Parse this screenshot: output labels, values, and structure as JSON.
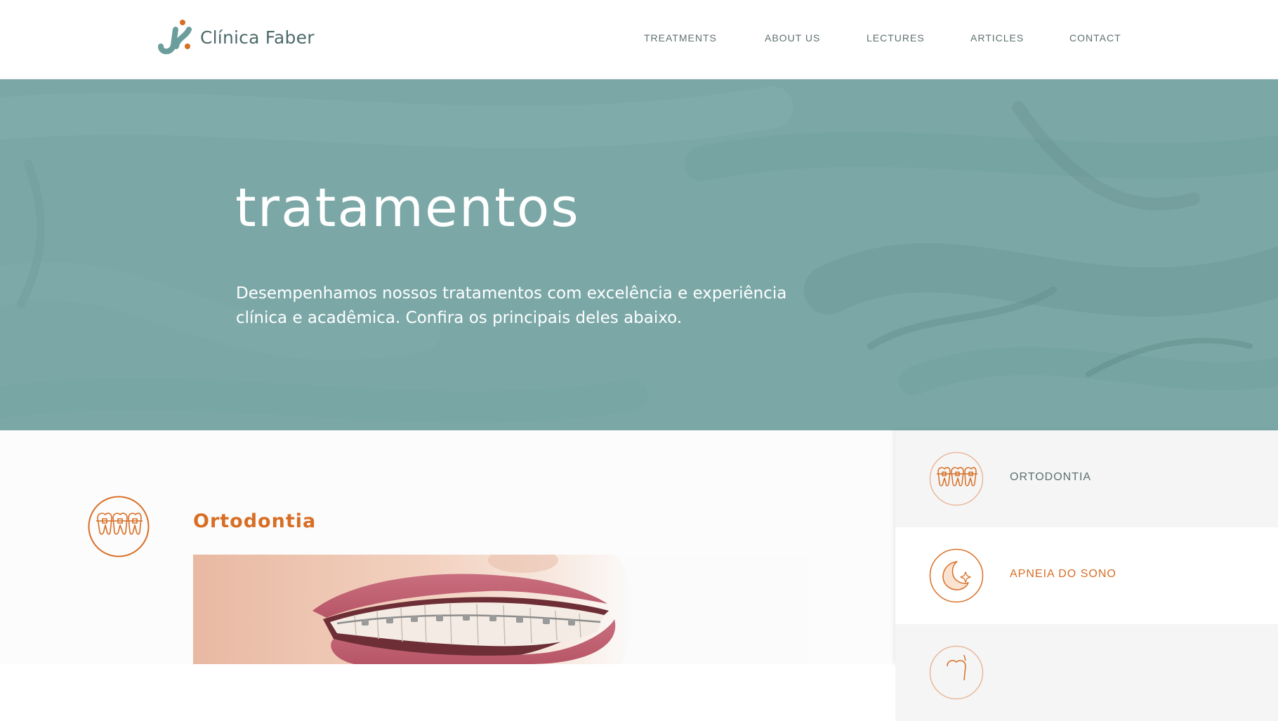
{
  "brand": {
    "name": "Clínica Faber",
    "accent_teal": "#6b9d9c",
    "accent_orange": "#d86e25"
  },
  "nav": {
    "items": [
      {
        "label": "TREATMENTS"
      },
      {
        "label": "ABOUT US"
      },
      {
        "label": "LECTURES"
      },
      {
        "label": "ARTICLES"
      },
      {
        "label": "CONTACT"
      }
    ]
  },
  "hero": {
    "title": "tratamentos",
    "description": "Desempenhamos nossos tratamentos com excelência e experiência clínica e acadêmica. Confira os principais deles abaixo.",
    "background_color": "#7ba8a7"
  },
  "section": {
    "title": "Ortodontia",
    "icon": "braces-teeth-icon",
    "image": "smile-with-braces-photo"
  },
  "sidebar": {
    "items": [
      {
        "label": "ORTODONTIA",
        "icon": "braces-teeth-icon",
        "state": "inactive"
      },
      {
        "label": "APNEIA DO SONO",
        "icon": "moon-star-icon",
        "state": "active"
      },
      {
        "label": "",
        "icon": "tooth-icon",
        "state": "inactive"
      }
    ]
  }
}
